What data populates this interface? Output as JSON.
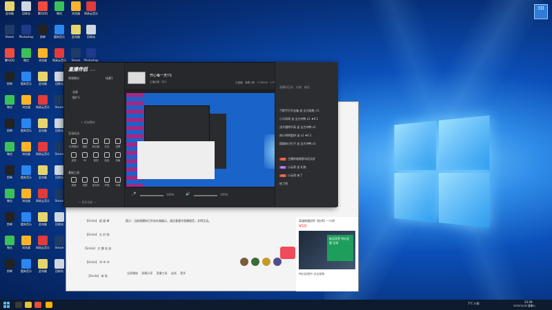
{
  "watermark": "3日",
  "desktop_icons": [
    {
      "label": "此电脑",
      "color": "#e6d56d"
    },
    {
      "label": "回收站",
      "color": "#cfd7e0"
    },
    {
      "label": "腾讯QQ",
      "color": "#f04b3e"
    },
    {
      "label": "微信",
      "color": "#3bc15a"
    },
    {
      "label": "浏览器",
      "color": "#ffb428"
    },
    {
      "label": "网易云音乐",
      "color": "#e23b3b"
    },
    {
      "label": "Steam",
      "color": "#1d3b66"
    },
    {
      "label": "Photoshop",
      "color": "#1f3a8a"
    },
    {
      "label": "剪映",
      "color": "#222222"
    },
    {
      "label": "酷狗音乐",
      "color": "#2b86f0"
    }
  ],
  "app": {
    "logo": "直播伴侣",
    "version": "v3.xx",
    "scene_mode": "常规模式",
    "scene_label": "场景1",
    "sources": [
      "全屏",
      "图片1"
    ],
    "add_source": "+ 添加素材",
    "section_interact": "互动玩法",
    "section_tools": "基础工具",
    "more": "— 更多功能 —",
    "interact_tiles": [
      "礼物展示",
      "福袋",
      "粉丝团",
      "红包",
      "投票",
      "连麦",
      "PK",
      "音效",
      "贴纸",
      "背景"
    ],
    "tool_tiles": [
      "美颜",
      "滤镜",
      "麦克风",
      "声音",
      "字幕"
    ],
    "stream_title": "开心每一天!!1",
    "header_tags": [
      "主播合集",
      "热门"
    ],
    "header_stats": [
      "已直播",
      "观看人数",
      "1776450",
      "1776453"
    ],
    "top_right": [
      "开播检测",
      "设置"
    ],
    "start_button": "开始直播 ▾",
    "mic_level": "100%",
    "speaker_level": "100%"
  },
  "chat": {
    "tabs": [
      "直播间互动",
      "礼物",
      "粉丝"
    ],
    "messages": [
      "弓箭手打开宝箱 送 全力助燃 ×1",
      "小马哥哥 送 全力冲鸭 x1 ♦0.1",
      "浅不懂得不离 送 全力冲鸭 x1",
      "热小明明爱拼 送 x1 ♦0.1",
      "翔翔的小钉子 送 全力冲鸭 x1",
      "主播你刚刚那句话太好",
      "小云哥 送 礼物",
      "小云哥 来了",
      "给了吧"
    ]
  },
  "back_window": {
    "notice": "提示：当前直播间已开启礼物展示，请注意遵守直播规范，文明互动。",
    "rows": [
      "【Smile】 超 级 棒",
      "【Smile】 太 好 啦",
      "【Smile】 主 播 加 油",
      "【Smile】 冲 冲 冲",
      "【Smile】 来 啦"
    ],
    "tools": [
      "全屏播放",
      "屏幕分享",
      "直播工具",
      "连线",
      "更多"
    ],
    "side_title": "英雄联盟冠军【技术】一小时",
    "side_price": "¥50",
    "side_promo": "新品享受 特价优惠 全场",
    "side_link": "特价促销中 点击抢购"
  },
  "taskbar": {
    "weather": "7°C 小雨",
    "time": "23:28",
    "date": "2025/12/20 星期六"
  }
}
